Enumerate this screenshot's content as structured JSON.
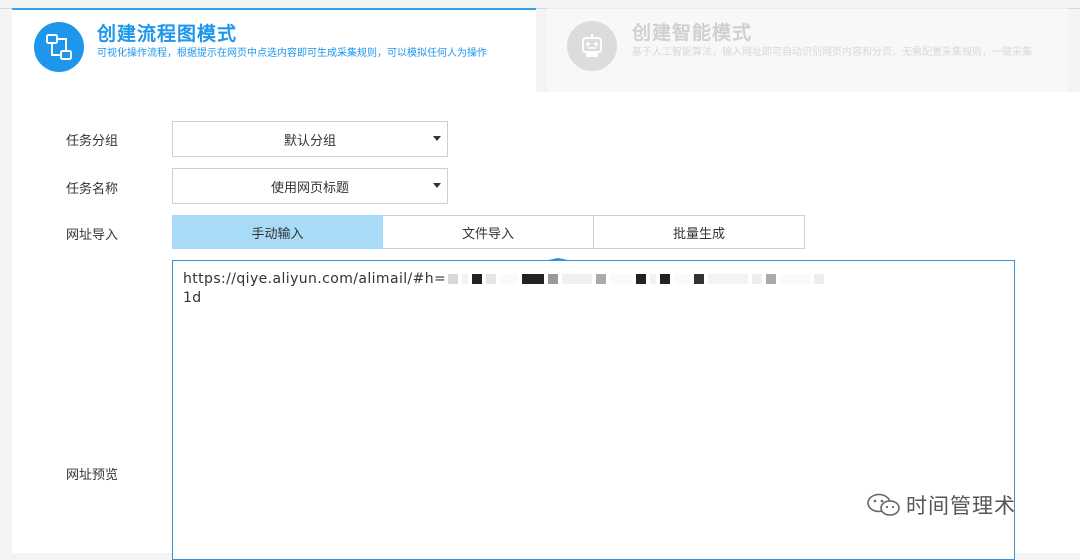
{
  "modes": {
    "flowchart": {
      "title": "创建流程图模式",
      "description": "可视化操作流程，根据提示在网页中点选内容即可生成采集规则，可以模拟任何人为操作",
      "icon": "flowchart-icon",
      "state": "active"
    },
    "smart": {
      "title": "创建智能模式",
      "description": "基于人工智能算法，输入网址即可自动识别网页内容和分页，无需配置采集规则，一键采集",
      "icon": "robot-icon",
      "state": "inactive"
    }
  },
  "form": {
    "task_group": {
      "label": "任务分组",
      "value": "默认分组"
    },
    "task_name": {
      "label": "任务名称",
      "value": "使用网页标题"
    },
    "url_import": {
      "label": "网址导入",
      "tabs": [
        "手动输入",
        "文件导入",
        "批量生成"
      ],
      "selected": "手动输入"
    },
    "url_preview": {
      "label": "网址预览",
      "url_prefix": "https://qiye.aliyun.com/alimail/#h=",
      "url_suffix": "1d"
    }
  },
  "watermark": {
    "text": "时间管理术",
    "icon": "wechat-icon"
  },
  "colors": {
    "accent": "#1d96ec",
    "selected_tab": "#a7dbf7",
    "border": "#cfcfcf"
  }
}
